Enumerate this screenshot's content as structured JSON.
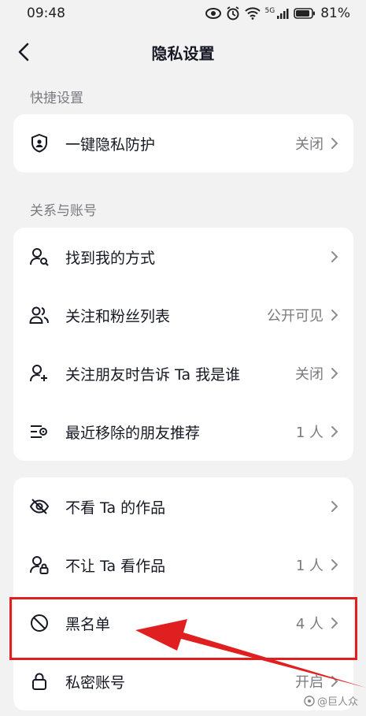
{
  "status": {
    "time": "09:48",
    "net_label": "5G",
    "battery": "81%"
  },
  "nav": {
    "title": "隐私设置"
  },
  "sections": {
    "quick": "快捷设置",
    "relations": "关系与账号"
  },
  "quick": {
    "privacy_protect": {
      "label": "一键隐私防护",
      "value": "关闭",
      "icon": "shield-person-icon"
    }
  },
  "relations": [
    {
      "label": "找到我的方式",
      "value": "",
      "icon": "person-search-icon"
    },
    {
      "label": "关注和粉丝列表",
      "value": "公开可见",
      "icon": "people-icon"
    },
    {
      "label": "关注朋友时告诉 Ta 我是谁",
      "value": "关闭",
      "icon": "person-add-icon"
    },
    {
      "label": "最近移除的朋友推荐",
      "value": "1 人",
      "icon": "list-view-icon"
    }
  ],
  "block": [
    {
      "label": "不看 Ta 的作品",
      "value": "",
      "icon": "eye-off-icon"
    },
    {
      "label": "不让 Ta 看作品",
      "value": "1 人",
      "icon": "person-lock-icon"
    },
    {
      "label": "黑名单",
      "value": "4 人",
      "icon": "block-icon"
    },
    {
      "label": "私密账号",
      "value": "开启",
      "icon": "lock-icon"
    }
  ],
  "watermark": "@巨人众",
  "colors": {
    "highlight": "#e02020",
    "accent_bg": "#f2f2f2"
  }
}
